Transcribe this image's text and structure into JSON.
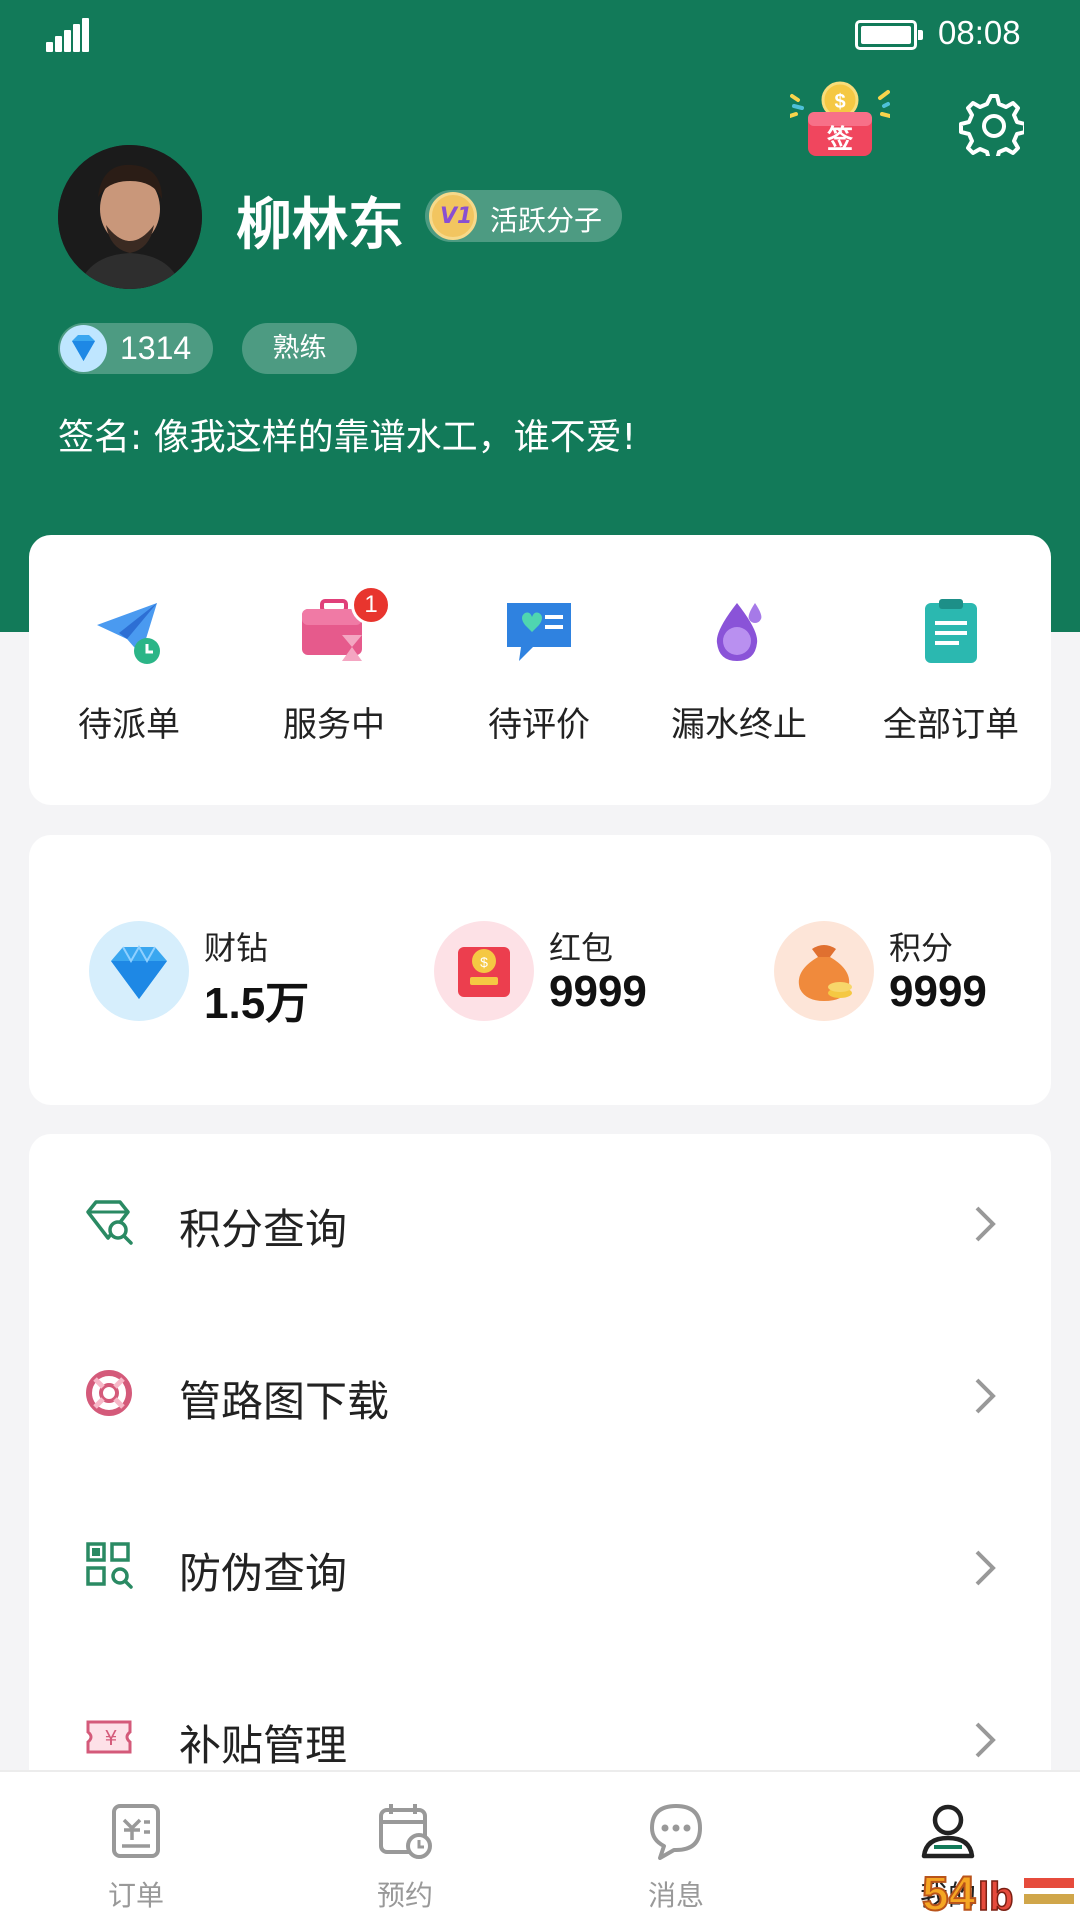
{
  "status_bar": {
    "time": "08:08"
  },
  "profile": {
    "name": "柳林东",
    "badge_label": "活跃分子",
    "diamond_count": "1314",
    "level": "熟练",
    "signature": "签名: 像我这样的靠谱水工，谁不爱!"
  },
  "header": {
    "signin_label": "签",
    "signin_coin": "$"
  },
  "orders": {
    "items": [
      {
        "label": "待派单",
        "icon": "paper-plane-clock-icon"
      },
      {
        "label": "服务中",
        "icon": "toolbox-hourglass-icon",
        "badge": "1"
      },
      {
        "label": "待评价",
        "icon": "chat-heart-icon"
      },
      {
        "label": "漏水终止",
        "icon": "water-drop-icon"
      },
      {
        "label": "全部订单",
        "icon": "clipboard-list-icon"
      }
    ]
  },
  "assets": [
    {
      "name": "财钻",
      "value": "1.5万",
      "icon": "diamond-icon"
    },
    {
      "name": "红包",
      "value": "9999",
      "icon": "red-envelope-icon"
    },
    {
      "name": "积分",
      "value": "9999",
      "icon": "money-bag-icon"
    }
  ],
  "menu": [
    {
      "label": "积分查询",
      "icon": "diamond-search-icon",
      "color": "#2a8a63"
    },
    {
      "label": "管路图下载",
      "icon": "lifebuoy-icon",
      "color": "#d45a7a"
    },
    {
      "label": "防伪查询",
      "icon": "qr-search-icon",
      "color": "#2a8a63"
    },
    {
      "label": "补贴管理",
      "icon": "ticket-yen-icon",
      "color": "#d45a7a"
    }
  ],
  "tabbar": {
    "items": [
      {
        "label": "订单",
        "icon": "order-icon"
      },
      {
        "label": "预约",
        "icon": "calendar-clock-icon"
      },
      {
        "label": "消息",
        "icon": "chat-bubble-icon"
      },
      {
        "label": "我的",
        "icon": "person-icon",
        "active": true
      }
    ]
  },
  "colors": {
    "brand": "#127a59",
    "badge_red": "#e8352e"
  }
}
